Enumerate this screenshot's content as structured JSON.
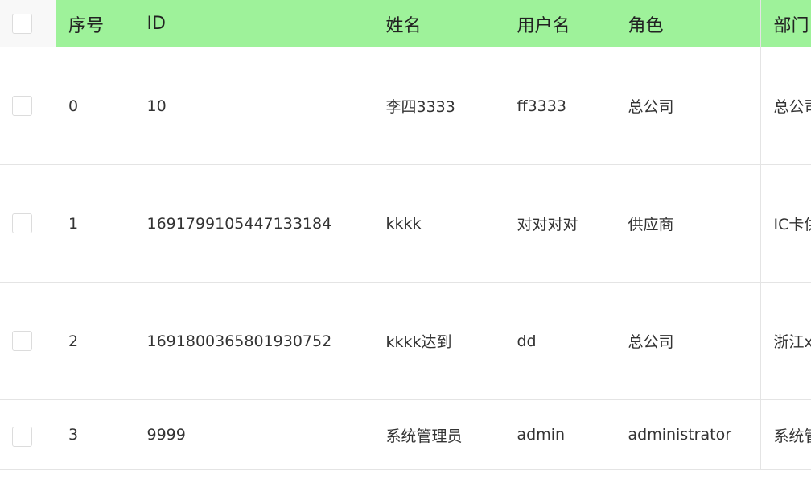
{
  "table": {
    "columns": [
      "序号",
      "ID",
      "姓名",
      "用户名",
      "角色",
      "部门"
    ],
    "rows": [
      {
        "index": "0",
        "id": "10",
        "name": "李四3333",
        "username": "ff3333",
        "role": "总公司",
        "dept": "总公司"
      },
      {
        "index": "1",
        "id": "1691799105447133184",
        "name": "kkkk",
        "username": "对对对对",
        "role": "供应商",
        "dept": "IC卡供"
      },
      {
        "index": "2",
        "id": "1691800365801930752",
        "name": "kkkk达到",
        "username": "dd",
        "role": "总公司",
        "dept": "浙江x"
      },
      {
        "index": "3",
        "id": "9999",
        "name": "系统管理员",
        "username": "admin",
        "role": "administrator",
        "dept": "系统管"
      }
    ]
  },
  "colors": {
    "header_bg": "#9ef29a",
    "border": "#e4e4e4",
    "text": "#333333"
  }
}
